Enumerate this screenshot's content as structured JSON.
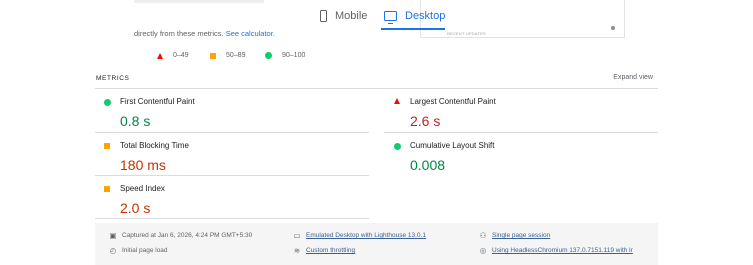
{
  "tabs": [
    {
      "label": "Mobile",
      "icon": "phone-icon",
      "active": false
    },
    {
      "label": "Desktop",
      "icon": "monitor-icon",
      "active": true
    }
  ],
  "thumbnail_caption": "RECENT UPDATES",
  "description": {
    "text": "directly from these metrics.",
    "link": "See calculator."
  },
  "legend": [
    {
      "range": "0–49",
      "icon": "fail-triangle-icon",
      "color": "#eb0f00"
    },
    {
      "range": "50–89",
      "icon": "average-square-icon",
      "color": "#ffa400"
    },
    {
      "range": "90–100",
      "icon": "pass-circle-icon",
      "color": "#0cce6b"
    }
  ],
  "metrics_header": {
    "title": "METRICS",
    "expand": "Expand view"
  },
  "metrics": [
    {
      "label": "First Contentful Paint",
      "value": "0.8 s",
      "rating": "good"
    },
    {
      "label": "Largest Contentful Paint",
      "value": "2.6 s",
      "rating": "poor"
    },
    {
      "label": "Total Blocking Time",
      "value": "180 ms",
      "rating": "average"
    },
    {
      "label": "Cumulative Layout Shift",
      "value": "0.008",
      "rating": "good"
    },
    {
      "label": "Speed Index",
      "value": "2.0 s",
      "rating": "average"
    }
  ],
  "footer": {
    "captured": "Captured at Jan 6, 2026, 4:24 PM GMT+5:30",
    "emulated": "Emulated Desktop with Lighthouse 13.0.1",
    "session": "Single page session",
    "load": "Initial page load",
    "throttling": "Custom throttling",
    "browser": "Using HeadlessChromium 137.0.7151.119 with lr"
  },
  "colors": {
    "accent": "#1a73e8",
    "good": "#018642",
    "average": "#c33300",
    "poor": "#c5221f"
  }
}
